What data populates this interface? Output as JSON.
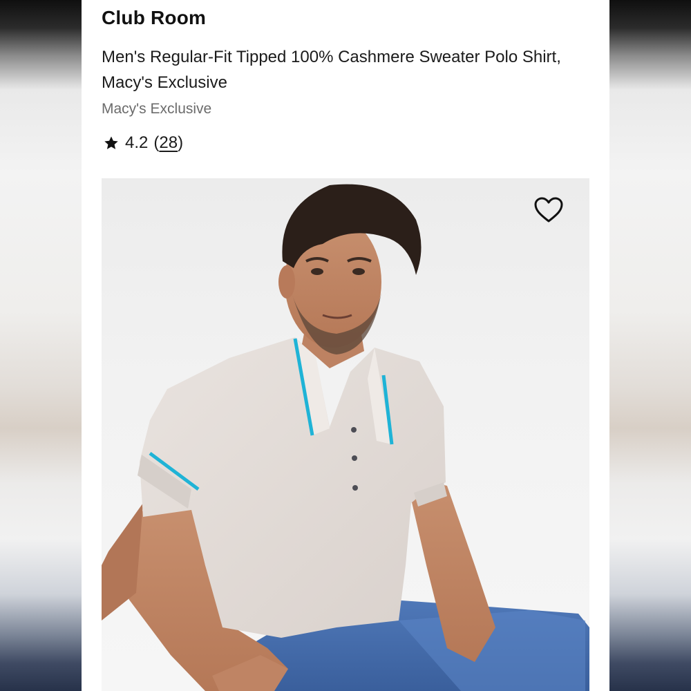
{
  "product": {
    "brand": "Club Room",
    "title": "Men's Regular-Fit Tipped 100% Cashmere Sweater Polo Shirt, Macy's Exclusive",
    "exclusive_label": "Macy's Exclusive",
    "rating": {
      "value": "4.2",
      "open_paren": "(",
      "count": "28",
      "close_paren": ")"
    },
    "image": {
      "alt": "Man in light grey cashmere polo shirt with turquoise tipping and blue jeans",
      "favorite_icon": "heart-icon"
    }
  },
  "colors": {
    "text_primary": "#111111",
    "text_secondary": "#6b6b6b",
    "accent_tipping": "#1fb3d6"
  }
}
